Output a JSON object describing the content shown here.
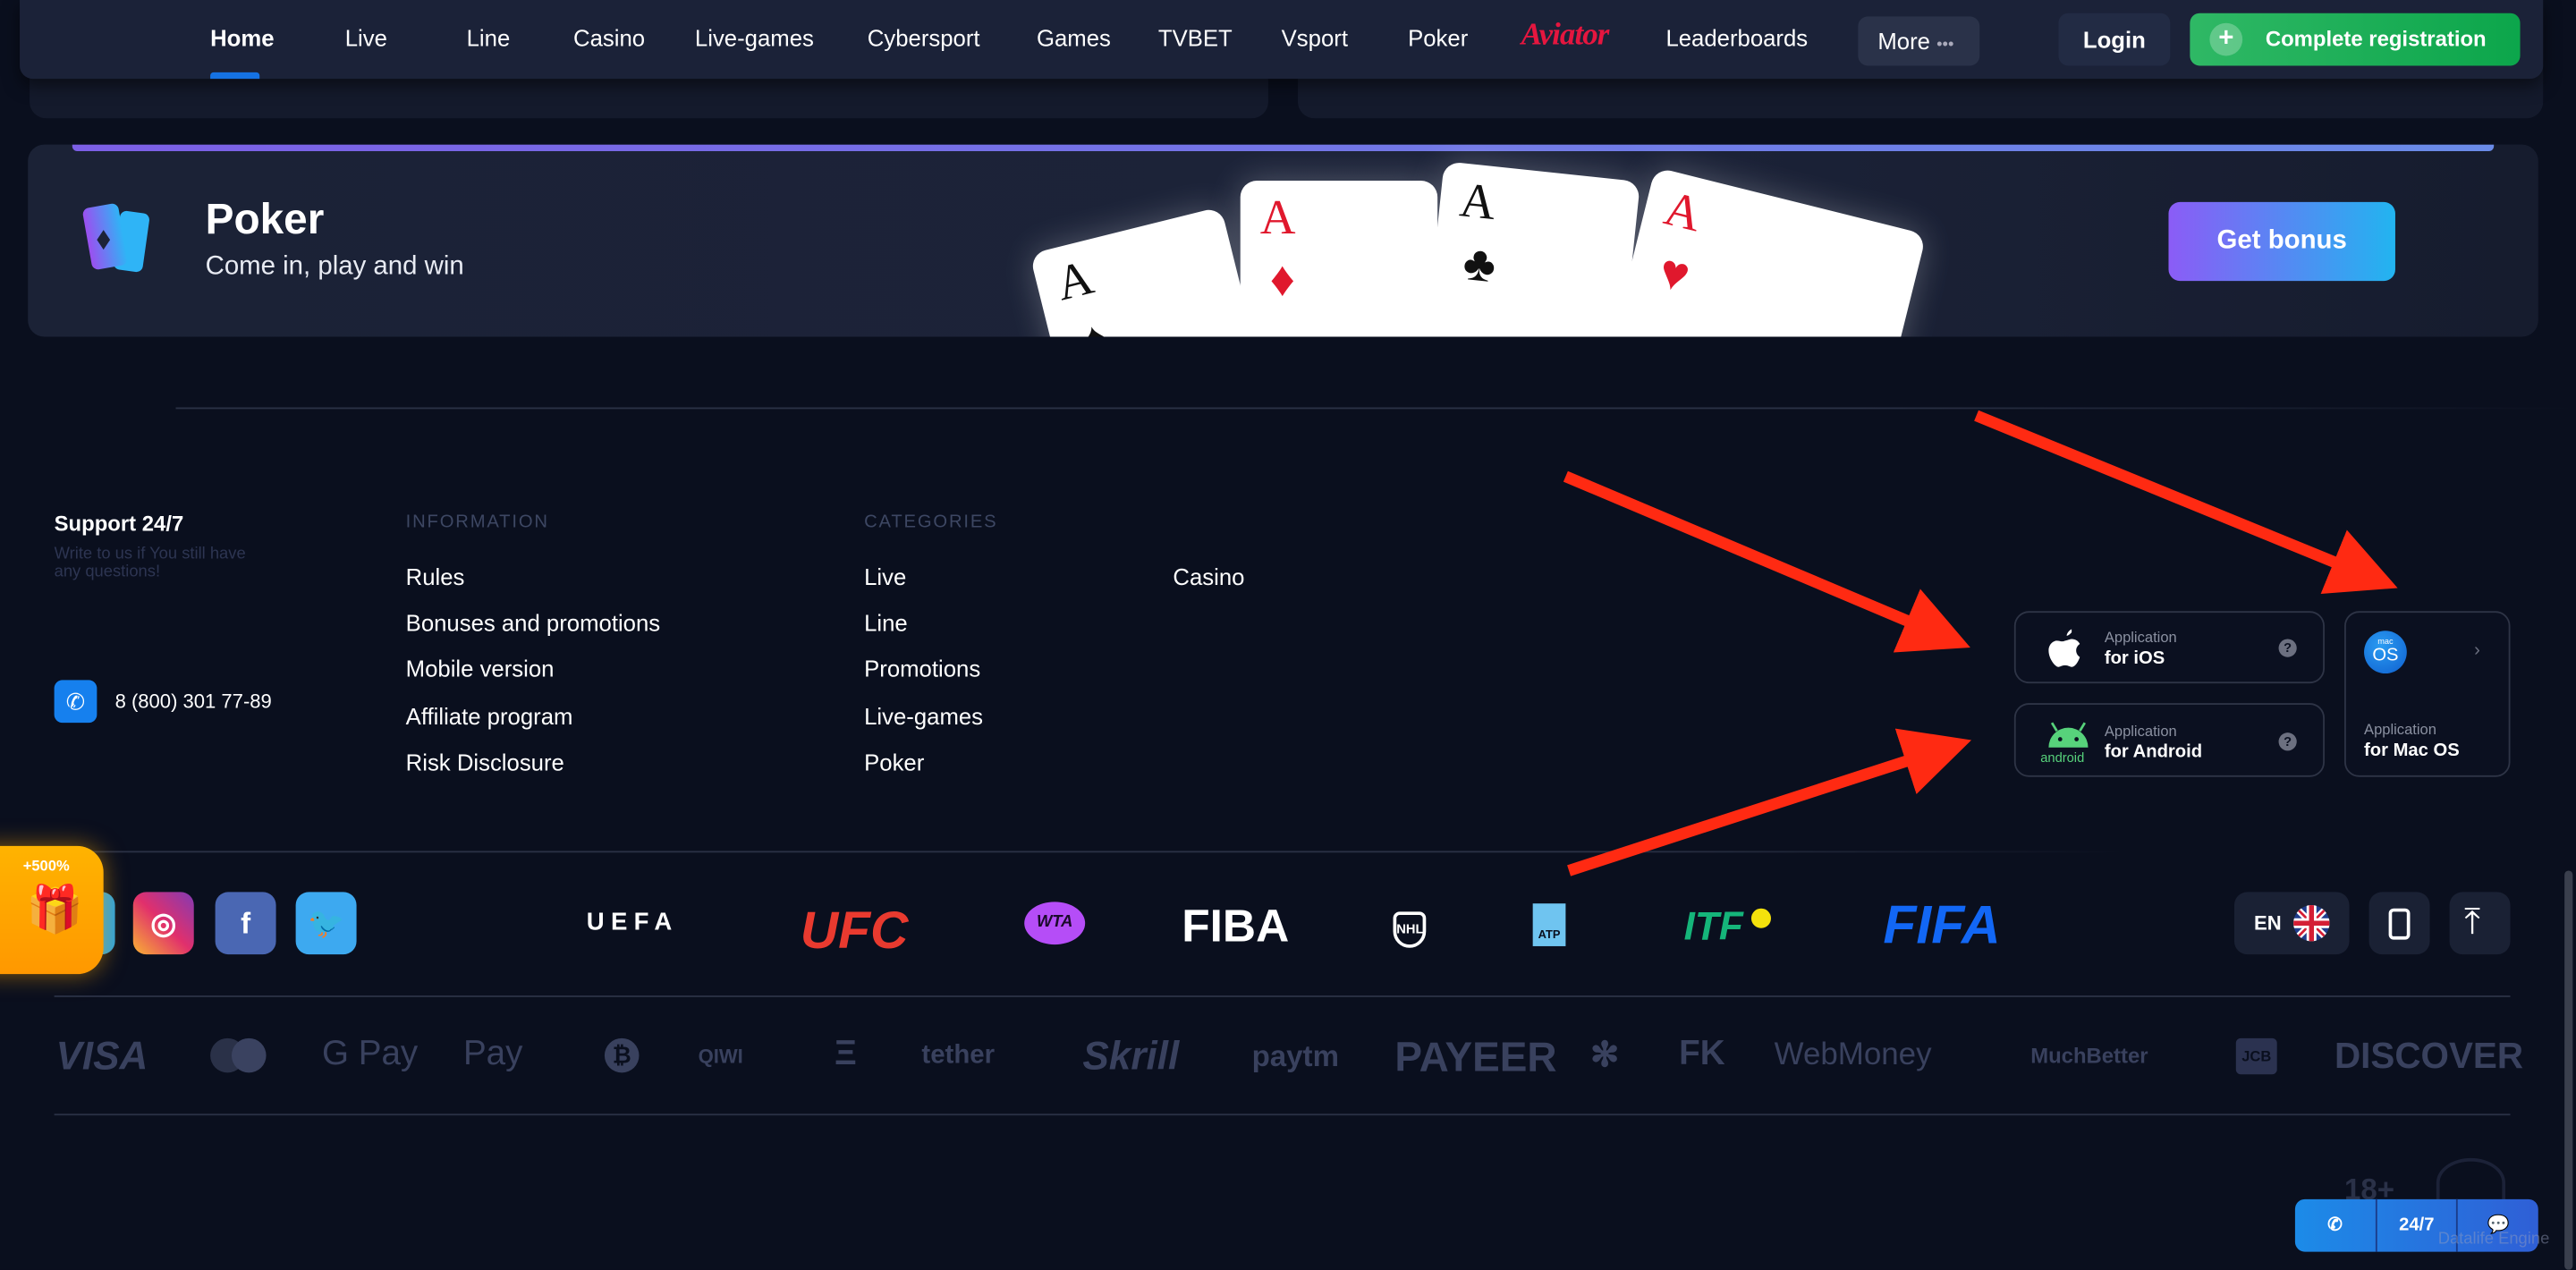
{
  "nav": {
    "items": [
      "Home",
      "Live",
      "Line",
      "Casino",
      "Live-games",
      "Cybersport",
      "Games",
      "TVBET",
      "Vsport",
      "Poker"
    ],
    "aviator": "Aviator",
    "leaderboards": "Leaderboards",
    "more": "More",
    "login": "Login",
    "register": "Complete registration",
    "active": "Home",
    "accent": "#1572e3",
    "register_color": "#1fb35a"
  },
  "banner": {
    "title": "Poker",
    "subtitle": "Come in, play and win",
    "button": "Get bonus",
    "card_rank": "A"
  },
  "footer": {
    "support_title": "Support 24/7",
    "support_text": "Write to us if You still have any questions!",
    "phone": "8 (800) 301 77-89",
    "info_heading": "INFORMATION",
    "info_links": [
      "Rules",
      "Bonuses and promotions",
      "Mobile version",
      "Affiliate program",
      "Risk Disclosure"
    ],
    "categories_heading": "CATEGORIES",
    "categories_col1": [
      "Live",
      "Line",
      "Promotions",
      "Live-games",
      "Poker"
    ],
    "categories_col2": [
      "Casino"
    ]
  },
  "apps": {
    "ios": {
      "small": "Application",
      "big": "for iOS"
    },
    "android": {
      "small": "Application",
      "big": "for Android",
      "logo_text": "android"
    },
    "mac": {
      "small": "Application",
      "big": "for Mac OS",
      "logo_top": "mac",
      "logo_bottom": "OS"
    }
  },
  "promo_badge": "+500%",
  "sports": [
    "UEFA",
    "UFC",
    "WTA",
    "FIBA",
    "NHL",
    "ATP",
    "ITF",
    "FIFA"
  ],
  "language": "EN",
  "payments": [
    "VISA",
    "",
    "G Pay",
    "Pay",
    "₿",
    "QIWI",
    "Ξ",
    "tether",
    "Skrill",
    "paytm",
    "PAYEER",
    "✻",
    "FK",
    "WebMoney",
    "MuchBetter",
    "JCB",
    "DISCOVER"
  ],
  "age": "18+",
  "chat": {
    "label": "24/7"
  },
  "watermark": "Datalife Engine",
  "annotation_color": "#ff2a12"
}
